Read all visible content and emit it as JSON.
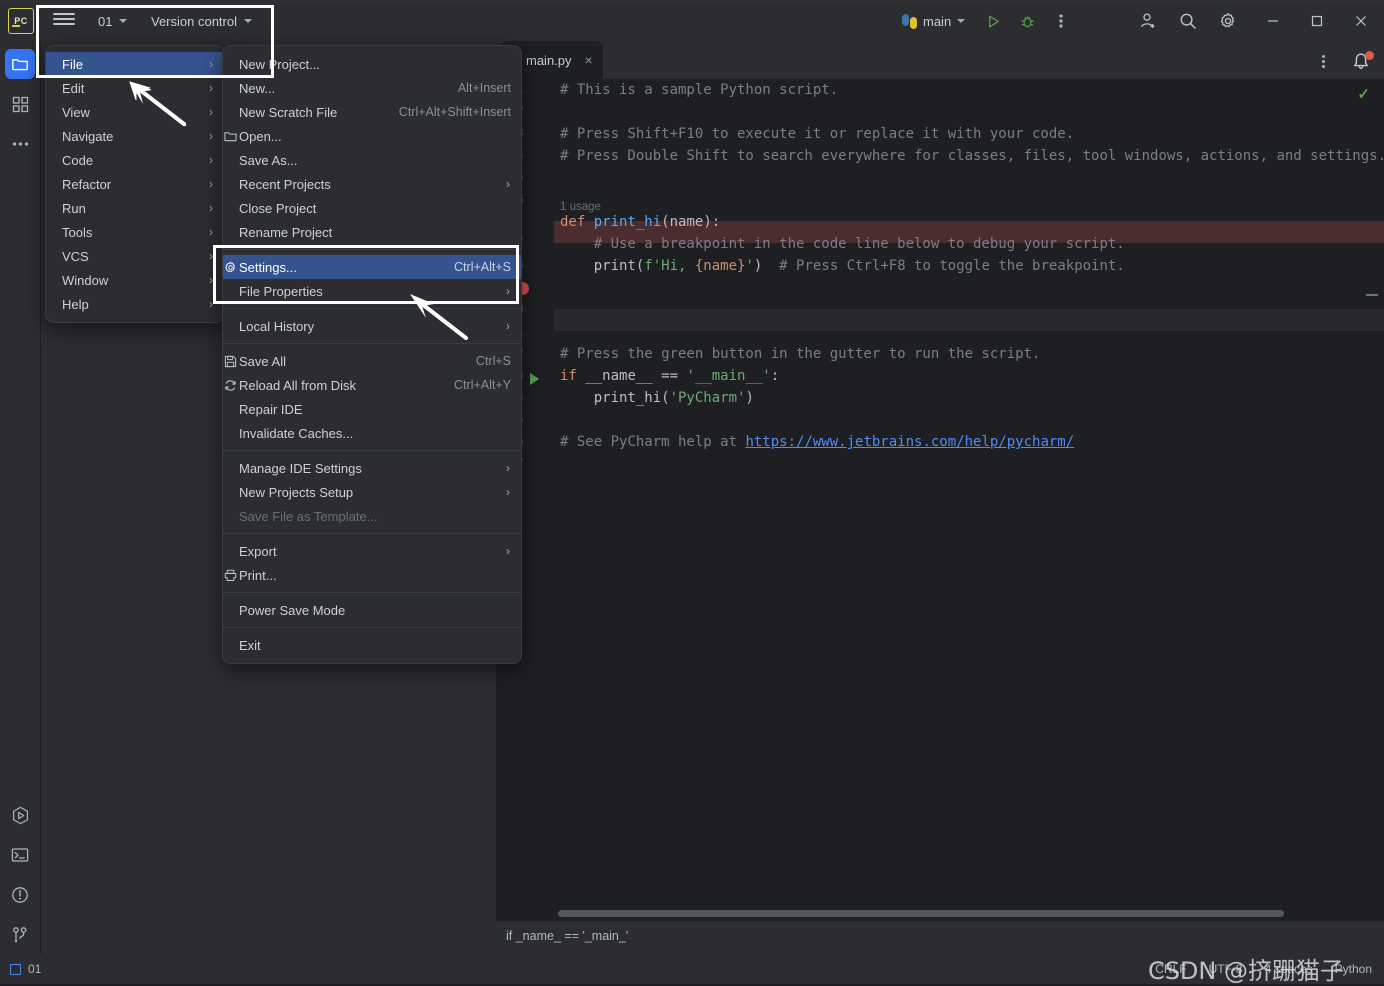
{
  "window": {
    "app_logo": "PC",
    "project_name": "01",
    "vcs_label": "Version control",
    "run_config": "main",
    "icons": {
      "hamburger": "hamburger-menu-icon",
      "run": "run-icon",
      "debug": "debug-icon",
      "more": "more-vertical-icon",
      "account": "user-add-icon",
      "search": "search-icon",
      "settings": "gear-icon",
      "minimize": "minimize-icon",
      "maximize": "maximize-icon",
      "close": "close-icon"
    }
  },
  "rail": {
    "top_items": [
      {
        "name": "project-tool-window",
        "icon": "folder-icon",
        "active": true
      },
      {
        "name": "structure-tool-window",
        "icon": "grid-squares-icon",
        "active": false
      },
      {
        "name": "more-tool-windows",
        "icon": "ellipsis-icon",
        "active": false
      }
    ],
    "bottom_items": [
      {
        "name": "run-tool-window",
        "icon": "play-hex-icon"
      },
      {
        "name": "terminal-tool-window",
        "icon": "terminal-icon"
      },
      {
        "name": "problems-tool-window",
        "icon": "warning-circle-icon"
      },
      {
        "name": "git-tool-window",
        "icon": "branch-icon"
      }
    ]
  },
  "main_menu": {
    "items": [
      {
        "label": "File",
        "submenu": true,
        "selected": true
      },
      {
        "label": "Edit",
        "submenu": true,
        "selected": false
      },
      {
        "label": "View",
        "submenu": true,
        "selected": false
      },
      {
        "label": "Navigate",
        "submenu": true,
        "selected": false
      },
      {
        "label": "Code",
        "submenu": true,
        "selected": false
      },
      {
        "label": "Refactor",
        "submenu": true,
        "selected": false
      },
      {
        "label": "Run",
        "submenu": true,
        "selected": false
      },
      {
        "label": "Tools",
        "submenu": true,
        "selected": false
      },
      {
        "label": "VCS",
        "submenu": true,
        "selected": false
      },
      {
        "label": "Window",
        "submenu": true,
        "selected": false
      },
      {
        "label": "Help",
        "submenu": true,
        "selected": false
      }
    ]
  },
  "file_menu": {
    "items": [
      {
        "type": "item",
        "label": "New Project...",
        "shortcut": "",
        "icon": "",
        "arrow": false
      },
      {
        "type": "item",
        "label": "New...",
        "shortcut": "Alt+Insert",
        "icon": "",
        "arrow": false
      },
      {
        "type": "item",
        "label": "New Scratch File",
        "shortcut": "Ctrl+Alt+Shift+Insert",
        "icon": "",
        "arrow": false
      },
      {
        "type": "item",
        "label": "Open...",
        "shortcut": "",
        "icon": "folder-icon",
        "arrow": false
      },
      {
        "type": "item",
        "label": "Save As...",
        "shortcut": "",
        "icon": "",
        "arrow": false
      },
      {
        "type": "item",
        "label": "Recent Projects",
        "shortcut": "",
        "icon": "",
        "arrow": true
      },
      {
        "type": "item",
        "label": "Close Project",
        "shortcut": "",
        "icon": "",
        "arrow": false
      },
      {
        "type": "item",
        "label": "Rename Project",
        "shortcut": "",
        "icon": "",
        "arrow": false
      },
      {
        "type": "sep"
      },
      {
        "type": "item",
        "label": "Settings...",
        "shortcut": "Ctrl+Alt+S",
        "icon": "gear-icon",
        "arrow": false,
        "selected": true
      },
      {
        "type": "item",
        "label": "File Properties",
        "shortcut": "",
        "icon": "",
        "arrow": true
      },
      {
        "type": "sep"
      },
      {
        "type": "item",
        "label": "Local History",
        "shortcut": "",
        "icon": "",
        "arrow": true
      },
      {
        "type": "sep"
      },
      {
        "type": "item",
        "label": "Save All",
        "shortcut": "Ctrl+S",
        "icon": "save-icon",
        "arrow": false
      },
      {
        "type": "item",
        "label": "Reload All from Disk",
        "shortcut": "Ctrl+Alt+Y",
        "icon": "refresh-icon",
        "arrow": false
      },
      {
        "type": "item",
        "label": "Repair IDE",
        "shortcut": "",
        "icon": "",
        "arrow": false
      },
      {
        "type": "item",
        "label": "Invalidate Caches...",
        "shortcut": "",
        "icon": "",
        "arrow": false
      },
      {
        "type": "sep"
      },
      {
        "type": "item",
        "label": "Manage IDE Settings",
        "shortcut": "",
        "icon": "",
        "arrow": true
      },
      {
        "type": "item",
        "label": "New Projects Setup",
        "shortcut": "",
        "icon": "",
        "arrow": true
      },
      {
        "type": "item",
        "label": "Save File as Template...",
        "shortcut": "",
        "icon": "",
        "arrow": false,
        "disabled": true
      },
      {
        "type": "sep"
      },
      {
        "type": "item",
        "label": "Export",
        "shortcut": "",
        "icon": "",
        "arrow": true
      },
      {
        "type": "item",
        "label": "Print...",
        "shortcut": "",
        "icon": "print-icon",
        "arrow": false
      },
      {
        "type": "sep"
      },
      {
        "type": "item",
        "label": "Power Save Mode",
        "shortcut": "",
        "icon": "",
        "arrow": false
      },
      {
        "type": "sep"
      },
      {
        "type": "item",
        "label": "Exit",
        "shortcut": "",
        "icon": "",
        "arrow": false
      }
    ]
  },
  "editor": {
    "tab": {
      "filename": "main.py",
      "modified_dot": true,
      "close": "×"
    },
    "inspection_status": "✓",
    "line_numbers": [
      "1",
      "2",
      "3",
      "4",
      "5",
      "6",
      "7",
      "8",
      "9",
      "10",
      "11",
      "12",
      "13",
      "14",
      "15",
      "16",
      "17"
    ],
    "breakpoint_line": 9,
    "run_gutter_line": 13,
    "usage_hint": {
      "line": 7,
      "text": "1 usage"
    },
    "lines": [
      {
        "n": 1,
        "text": "# This is a sample Python script."
      },
      {
        "n": 2,
        "text": ""
      },
      {
        "n": 3,
        "text": "# Press Shift+F10 to execute it or replace it with your code."
      },
      {
        "n": 4,
        "text": "# Press Double Shift to search everywhere for classes, files, tool windows, actions, and settings."
      },
      {
        "n": 5,
        "text": ""
      },
      {
        "n": 6,
        "text": ""
      },
      {
        "n": 7,
        "text": "def print_hi(name):"
      },
      {
        "n": 8,
        "text": "    # Use a breakpoint in the code line below to debug your script."
      },
      {
        "n": 9,
        "text": "    print(f'Hi, {name}')  # Press Ctrl+F8 to toggle the breakpoint."
      },
      {
        "n": 10,
        "text": ""
      },
      {
        "n": 11,
        "text": ""
      },
      {
        "n": 12,
        "text": "# Press the green button in the gutter to run the script."
      },
      {
        "n": 13,
        "text": "if __name__ == '__main__':"
      },
      {
        "n": 14,
        "text": "    print_hi('PyCharm')"
      },
      {
        "n": 15,
        "text": ""
      },
      {
        "n": 16,
        "text": "# See PyCharm help at https://www.jetbrains.com/help/pycharm/"
      },
      {
        "n": 17,
        "text": ""
      }
    ],
    "link_url": "https://www.jetbrains.com/help/pycharm/"
  },
  "breadcrumb": "if _name_ == '_main_'",
  "status_bar": {
    "left_label": "01",
    "line_ending": "CRLF",
    "encoding": "UTF-8",
    "indent": "4 spaces",
    "interpreter": "Python"
  },
  "watermark": {
    "text": "CSDN @挤跚猫子"
  },
  "colors": {
    "accent": "#3574f0",
    "menu_selection": "#35538f",
    "breakpoint": "#d5504f",
    "run_green": "#5a9e4b",
    "highlight_box": "#ffffff",
    "editor_bg": "#1e1f22",
    "panel_bg": "#2b2d30"
  }
}
